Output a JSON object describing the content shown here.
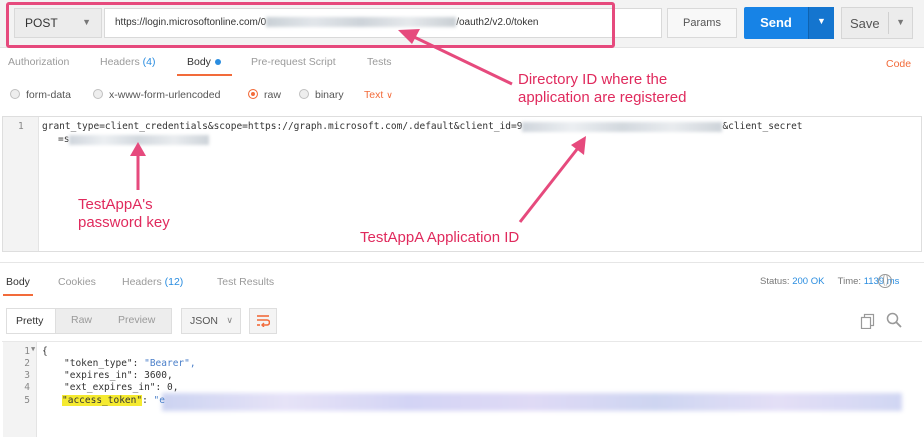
{
  "request": {
    "method": "POST",
    "url_prefix": "https://login.microsoftonline.com/0",
    "url_suffix": "/oauth2/v2.0/token",
    "params_label": "Params",
    "send_label": "Send",
    "save_label": "Save"
  },
  "request_tabs": {
    "authorization": "Authorization",
    "headers": "Headers",
    "headers_count": "(4)",
    "body": "Body",
    "pre_request": "Pre-request Script",
    "tests": "Tests",
    "code": "Code"
  },
  "body_types": {
    "form_data": "form-data",
    "urlencoded": "x-www-form-urlencoded",
    "raw": "raw",
    "binary": "binary",
    "text_format": "Text"
  },
  "request_body": {
    "line_number": "1",
    "line1_start": "grant_type=client_credentials&scope=https://graph.microsoft.com/.default&client_id=9",
    "line1_end": "&client_secret",
    "line2_start": "=s"
  },
  "annotations": {
    "directory_id_line1": "Directory ID where the",
    "directory_id_line2": "application are registered",
    "password_line1": "TestAppA's",
    "password_line2": "password key",
    "application_id": "TestAppA Application ID"
  },
  "response_tabs": {
    "body": "Body",
    "cookies": "Cookies",
    "headers": "Headers",
    "headers_count": "(12)",
    "test_results": "Test Results"
  },
  "response_status": {
    "status_label": "Status:",
    "status_value": "200 OK",
    "time_label": "Time:",
    "time_value": "1139 ms"
  },
  "response_format": {
    "pretty": "Pretty",
    "raw": "Raw",
    "preview": "Preview",
    "json": "JSON"
  },
  "response_body": {
    "lines": [
      {
        "no": "1",
        "text": "{"
      },
      {
        "no": "2",
        "key": "\"token_type\"",
        "value": "\"Bearer\","
      },
      {
        "no": "3",
        "key": "\"expires_in\"",
        "value": "3600,"
      },
      {
        "no": "4",
        "key": "\"ext_expires_in\"",
        "value": "0,"
      },
      {
        "no": "5",
        "key": "\"access_token\"",
        "value": "\"e"
      }
    ]
  },
  "colors": {
    "accent": "#f26b3a",
    "send": "#1783e6",
    "annotation": "#e02a5d",
    "highlight": "#f5ea30"
  }
}
